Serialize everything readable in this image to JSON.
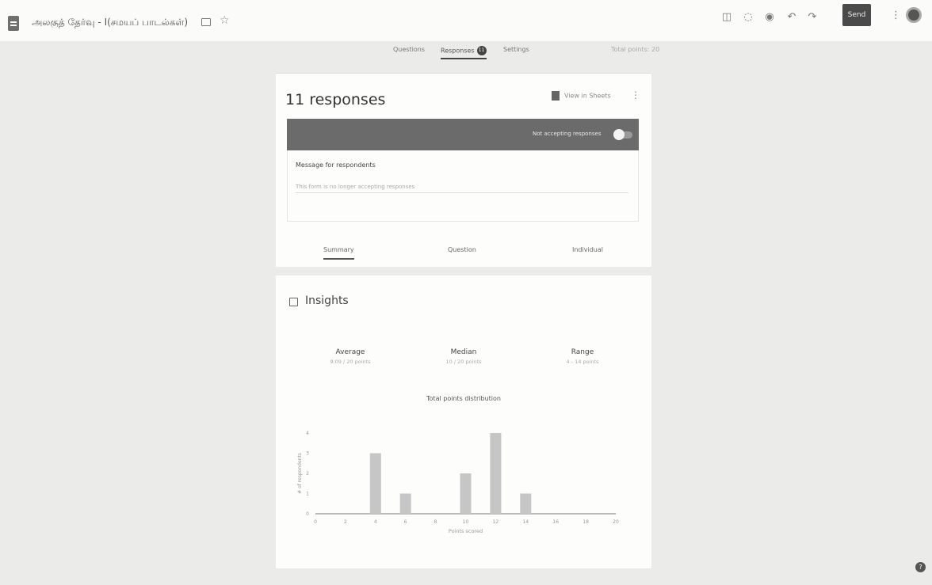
{
  "header": {
    "doc_title": "அலகுத் தேர்வு - I(சமயப் பாடல்கள்)",
    "send_label": "Send"
  },
  "tabs": {
    "questions": "Questions",
    "responses": "Responses",
    "responses_count": "11",
    "settings": "Settings",
    "total_points": "Total points: 20"
  },
  "summary_card": {
    "title": "11 responses",
    "view_in_sheets": "View in Sheets",
    "banner_text": "Not accepting responses",
    "message_label": "Message for respondents",
    "message_value": "This form is no longer accepting responses",
    "subtabs": [
      "Summary",
      "Question",
      "Individual"
    ]
  },
  "insights": {
    "title": "Insights",
    "stats": [
      {
        "label": "Average",
        "value": "9.09 / 20 points"
      },
      {
        "label": "Median",
        "value": "10 / 20 points"
      },
      {
        "label": "Range",
        "value": "4 - 14 points"
      }
    ]
  },
  "chart_data": {
    "type": "bar",
    "title": "Total points distribution",
    "xlabel": "Points scored",
    "ylabel": "# of respondents",
    "x_ticks": [
      0,
      2,
      4,
      6,
      8,
      10,
      12,
      14,
      16,
      18,
      20
    ],
    "y_ticks": [
      0,
      1,
      2,
      3,
      4
    ],
    "ylim": [
      0,
      4
    ],
    "x": [
      4,
      6,
      10,
      12,
      14
    ],
    "values": [
      3,
      1,
      2,
      4,
      1
    ],
    "bar_color": "#c6c6c6"
  }
}
